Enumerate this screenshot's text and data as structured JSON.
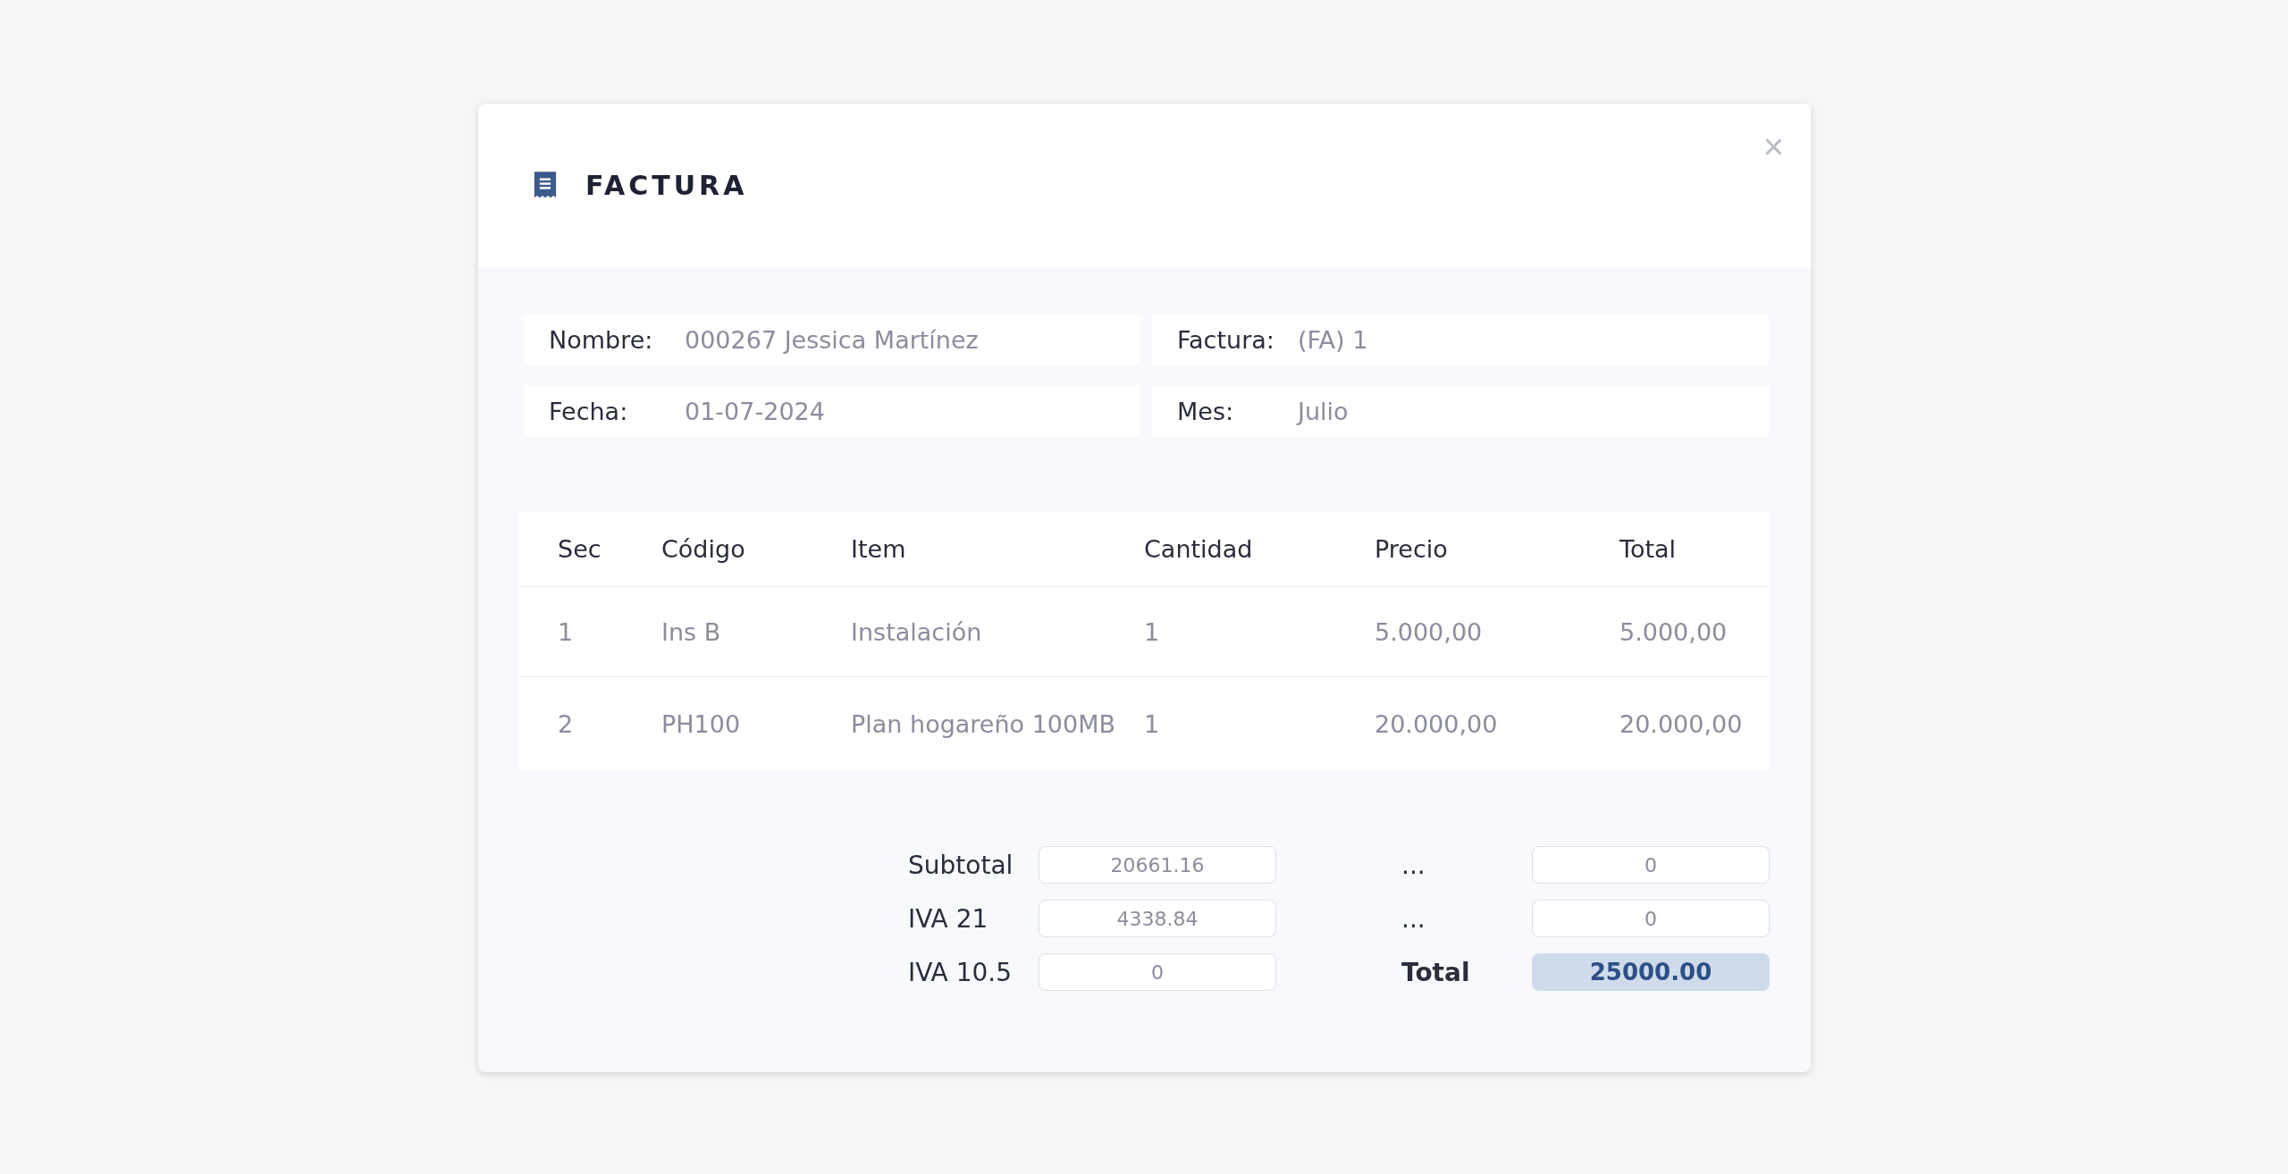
{
  "dialog": {
    "title": "FACTURA",
    "close": "×"
  },
  "info": [
    {
      "label": "Nombre:",
      "value": "000267 Jessica Martínez"
    },
    {
      "label": "Factura:",
      "value": "(FA) 1"
    },
    {
      "label": "Fecha:",
      "value": "01-07-2024"
    },
    {
      "label": "Mes:",
      "value": "Julio"
    }
  ],
  "table": {
    "columns": [
      "Sec",
      "Código",
      "Item",
      "Cantidad",
      "Precio",
      "Total"
    ],
    "rows": [
      [
        "1",
        "Ins B",
        "Instalación",
        "1",
        "5.000,00",
        "5.000,00"
      ],
      [
        "2",
        "PH100",
        "Plan hogareño 100MB",
        "1",
        "20.000,00",
        "20.000,00"
      ]
    ]
  },
  "totals": {
    "left": [
      {
        "label": "Subtotal",
        "value": "20661.16",
        "kind": "plain"
      },
      {
        "label": "IVA 21",
        "value": "4338.84",
        "kind": "plain"
      },
      {
        "label": "IVA 10.5",
        "value": "0",
        "kind": "plain"
      }
    ],
    "right": [
      {
        "label": "...",
        "value": "0",
        "kind": "plain"
      },
      {
        "label": "...",
        "value": "0",
        "kind": "plain"
      },
      {
        "label": "Total",
        "value": "25000.00",
        "kind": "grand"
      }
    ]
  }
}
